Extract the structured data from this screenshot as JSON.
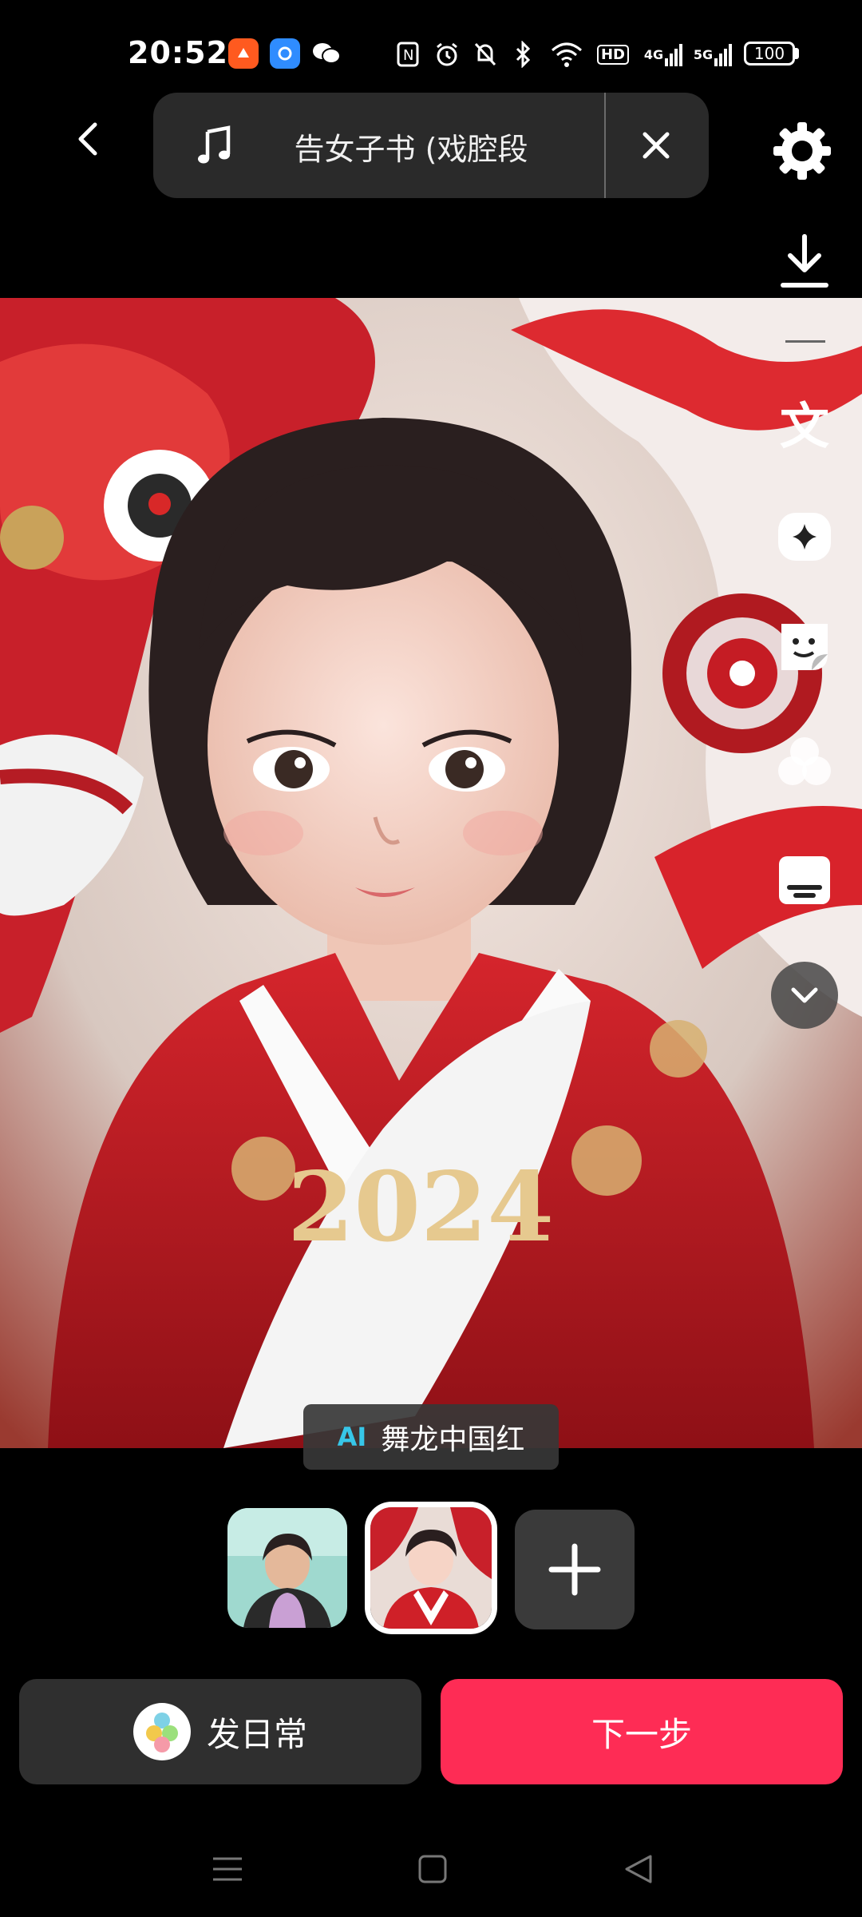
{
  "status_bar": {
    "time": "20:52",
    "network_4g": "4G",
    "network_5g": "5G",
    "hd": "HD",
    "battery": "100"
  },
  "top_bar": {
    "music_title": "告女子书 (戏腔段"
  },
  "right_tools": {
    "text_tool_glyph": "文"
  },
  "hero": {
    "overlay_text": "2024"
  },
  "ai_tag": {
    "badge": "AI",
    "label": "舞龙中国红"
  },
  "bottom": {
    "daily_label": "发日常",
    "next_label": "下一步"
  },
  "colors": {
    "accent": "#fe2c55",
    "ai_badge": "#37c6e8",
    "pill_bg": "#2a2a2a"
  },
  "icons": [
    "back-icon",
    "music-note-icon",
    "close-icon",
    "settings-icon",
    "download-icon",
    "text-icon",
    "sparkle-icon",
    "sticker-icon",
    "filter-icon",
    "caption-icon",
    "chevron-down-icon",
    "plus-icon",
    "menu-nav-icon",
    "home-nav-icon",
    "back-nav-icon"
  ]
}
